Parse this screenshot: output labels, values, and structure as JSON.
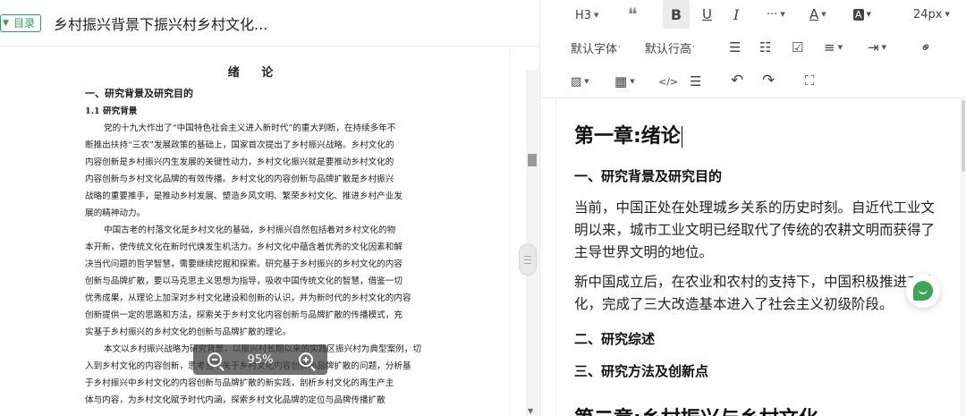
{
  "left_panel": {
    "toc_button": "目录",
    "doc_title": "乡村振兴背景下振兴村乡村文化...",
    "zoom": "95%",
    "page": {
      "title": "绪 论",
      "section1": "一、研究背景及研究目的",
      "sub1": "1.1 研究背景",
      "lines": [
        "党的十九大作出了“中国特色社会主义进入新时代”的重大判断，在持续多年不",
        "断推出扶持“三农”发展政策的基础上，国家首次提出了乡村振兴战略。乡村文化的",
        "内容创新是乡村振兴内生发展的关键性动力，乡村文化振兴就是要推动乡村文化的",
        "内容创新与乡村文化品牌的有效传播。乡村文化的内容创新与品牌扩散是乡村振兴",
        "战略的重要推手，是推动乡村发展、塑造乡风文明、繁荣乡村文化、推进乡村产业发",
        "展的精神动力。",
        "中国古老的村落文化是乡村文化的基础，乡村振兴自然包括着对乡村文化的物",
        "本开新，使传统文化在新时代焕发生机活力。乡村文化中蕴含着优秀的文化因素和解",
        "决当代问题的哲学智慧，需要继续挖掘和探索。研究基于乡村振兴的乡村文化的内容",
        "创新与品牌扩散，要以马克思主义思想为指导，吸收中国传统文化的智慧，借鉴一切",
        "优秀成果，从理论上加深对乡村文化建设和创新的认识，并为新时代的乡村文化的内容",
        "创新提供一定的思路和方法，探索关于乡村文化内容创新与品牌扩散的传播模式，充",
        "实基于乡村振兴的乡村文化的创新与品牌扩散的理论。",
        "本文以乡村振兴战略为研究背景，以振兴村长期以来的实践区振兴村为典型案例，切",
        "入到乡村文化的内容创新，思考当下关于乡村文化内容创新与品牌扩散的问题，分析基",
        "于乡村振兴中乡村文化的内容创新与品牌扩散的新实践，剖析乡村文化的再生产主",
        "体与内容，为乡村文化赋予时代内涵，探索乡村文化品牌的定位与品牌传播扩散"
      ]
    }
  },
  "toolbar": {
    "heading": "H3",
    "font_size": "24px",
    "font_family": "默认字体",
    "line_height": "默认行高",
    "icons": [
      "quote-icon",
      "bold-icon",
      "underline-icon",
      "italic-icon",
      "more-icon",
      "font-color-icon",
      "highlight-icon",
      "bullet-list-icon",
      "numbered-list-icon",
      "checklist-icon",
      "align-icon",
      "indent-icon",
      "link-icon",
      "image-icon",
      "table-icon",
      "code-icon",
      "divider-icon",
      "undo-icon",
      "redo-icon",
      "fullscreen-icon"
    ]
  },
  "editor": {
    "h1": "第一章:绪论",
    "h2a": "一、研究背景及研究目的",
    "p1": "当前，中国正处在处理城乡关系的历史时刻。自近代工业文明以来，城市工业文明已经取代了传统的农耕文明而获得了主导世界文明的地位。",
    "p2": "新中国成立后，在农业和农村的支持下，中国积极推进工业化，完成了三大改造基本进入了社会主义初级阶段。",
    "h2b": "二、研究综述",
    "h2c": "三、研究方法及创新点",
    "h1b": "第二章:乡村振兴与乡村文化"
  },
  "colors": {
    "accent": "#2aa55a",
    "leaf": "#3aa757"
  }
}
